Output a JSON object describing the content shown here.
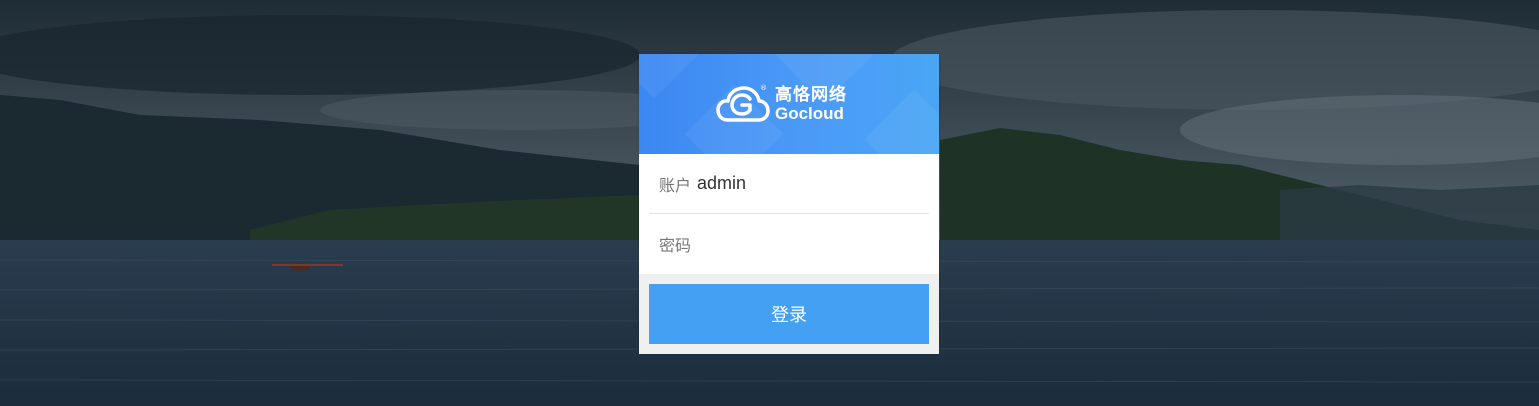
{
  "brand": {
    "name_cn": "高恪网络",
    "name_en": "Gocloud",
    "logo_icon": "cloud-logo-icon",
    "registered_mark": "®"
  },
  "form": {
    "account_label": "账户",
    "account_value": "admin",
    "password_label": "密码",
    "password_value": ""
  },
  "actions": {
    "login_label": "登录"
  },
  "colors": {
    "header_gradient_start": "#3b87f2",
    "header_gradient_end": "#4aa6f5",
    "button": "#44a0f3",
    "card_background": "#ffffff"
  }
}
